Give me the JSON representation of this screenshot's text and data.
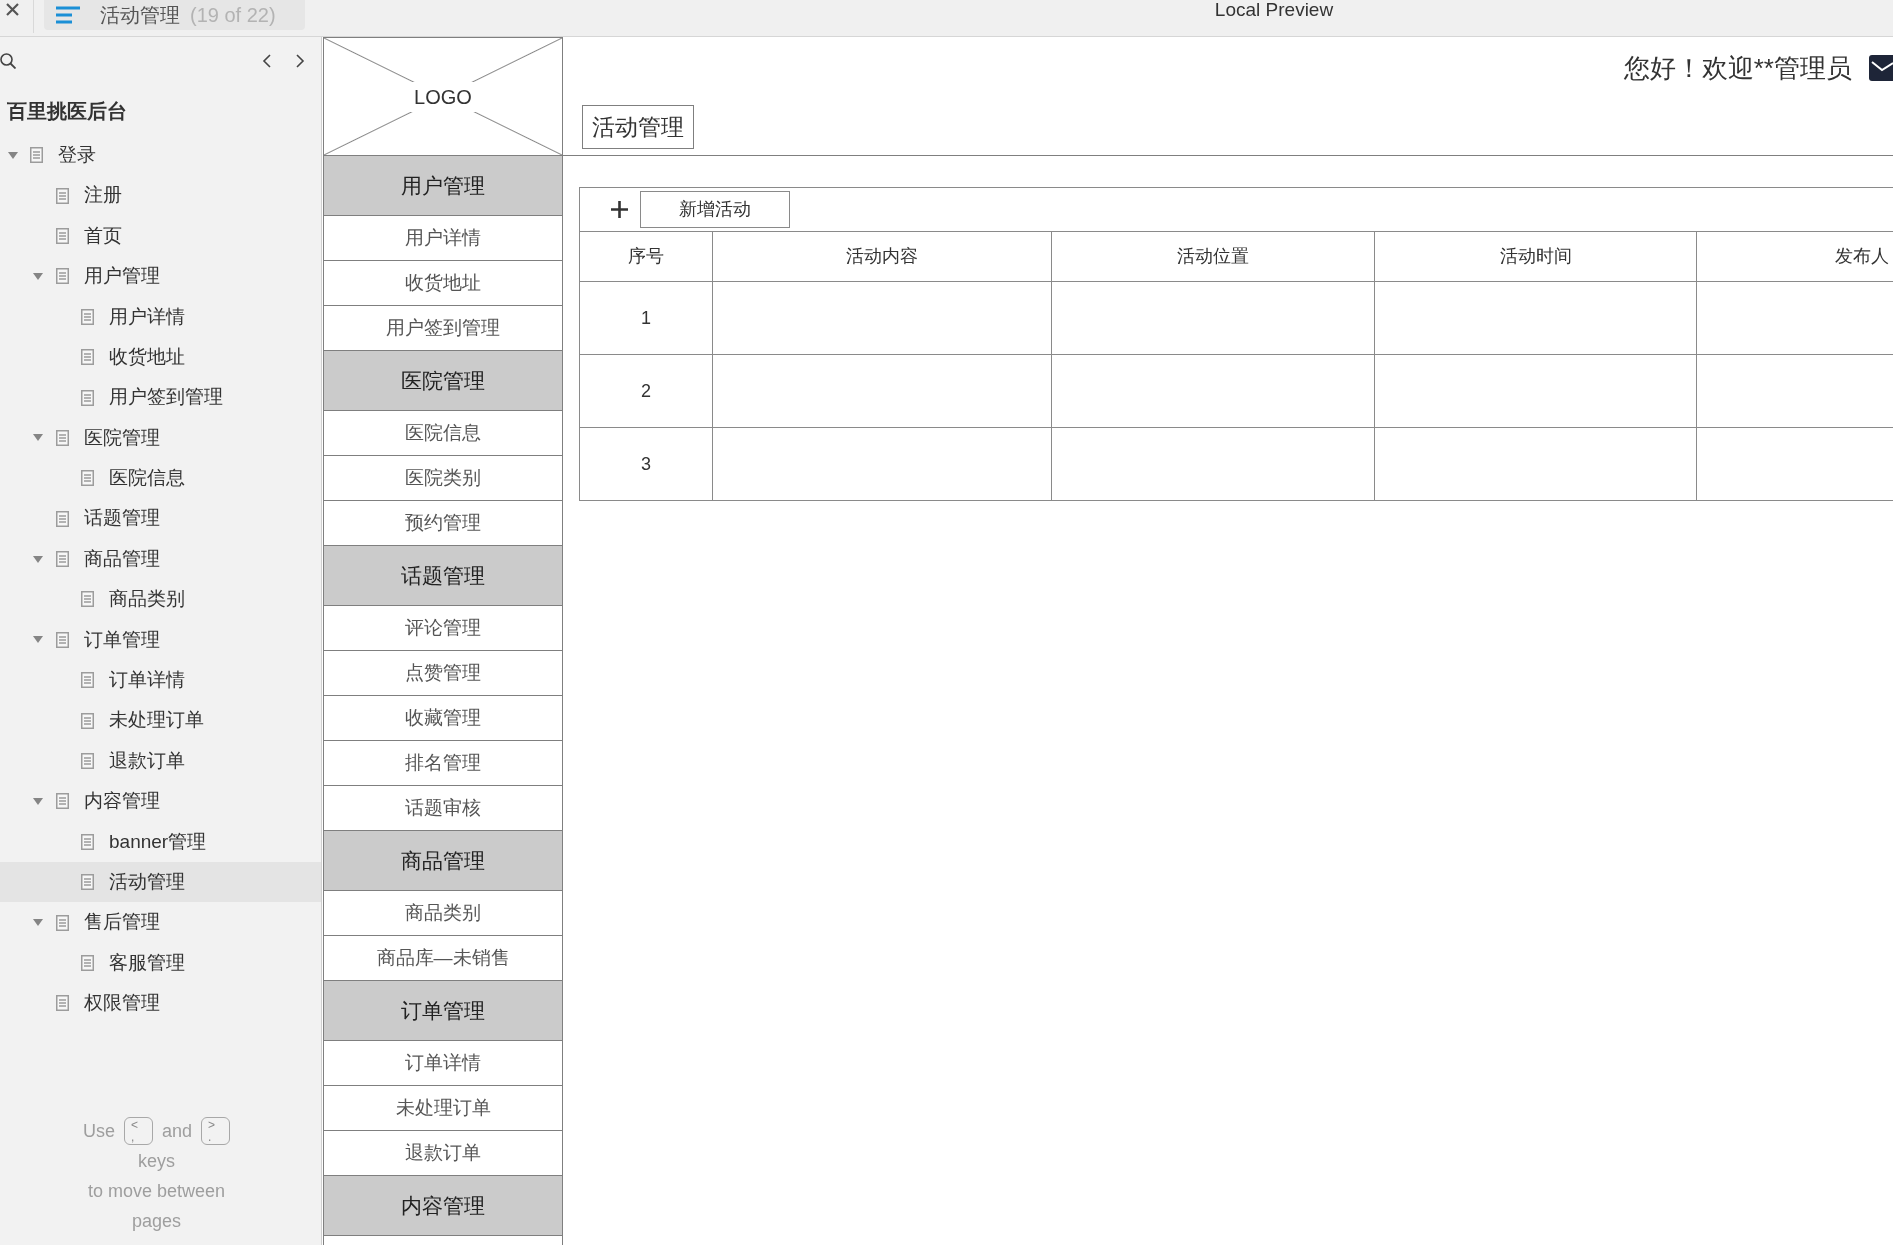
{
  "top_bar": {
    "tab": {
      "title": "活动管理",
      "count": "(19 of 22)"
    },
    "window_title": "Local Preview"
  },
  "sidebar": {
    "project_title": "百里挑医后台",
    "tree": [
      {
        "label": "登录",
        "expanded": true,
        "selected": false,
        "children": [
          {
            "label": "注册",
            "selected": false
          },
          {
            "label": "首页",
            "selected": false
          },
          {
            "label": "用户管理",
            "expanded": true,
            "selected": false,
            "children": [
              {
                "label": "用户详情",
                "selected": false
              },
              {
                "label": "收货地址",
                "selected": false
              },
              {
                "label": "用户签到管理",
                "selected": false
              }
            ]
          },
          {
            "label": "医院管理",
            "expanded": true,
            "selected": false,
            "children": [
              {
                "label": "医院信息",
                "selected": false
              }
            ]
          },
          {
            "label": "话题管理",
            "selected": false
          },
          {
            "label": "商品管理",
            "expanded": true,
            "selected": false,
            "children": [
              {
                "label": "商品类别",
                "selected": false
              }
            ]
          },
          {
            "label": "订单管理",
            "expanded": true,
            "selected": false,
            "children": [
              {
                "label": "订单详情",
                "selected": false
              },
              {
                "label": "未处理订单",
                "selected": false
              },
              {
                "label": "退款订单",
                "selected": false
              }
            ]
          },
          {
            "label": "内容管理",
            "expanded": true,
            "selected": false,
            "children": [
              {
                "label": "banner管理",
                "selected": false
              },
              {
                "label": "活动管理",
                "selected": true
              }
            ]
          },
          {
            "label": "售后管理",
            "expanded": true,
            "selected": false,
            "children": [
              {
                "label": "客服管理",
                "selected": false
              }
            ]
          },
          {
            "label": "权限管理",
            "selected": false
          }
        ]
      }
    ],
    "key_hint": {
      "lead": "Use",
      "keys": [
        {
          "upper": "<",
          "lower": ","
        },
        {
          "upper": ">",
          "lower": "."
        }
      ],
      "joiner": "and",
      "lines": [
        "keys",
        "to move between",
        "pages"
      ]
    }
  },
  "nav_menu": {
    "logo_text": "LOGO",
    "groups": [
      {
        "title": "用户管理",
        "items": [
          "用户详情",
          "收货地址",
          "用户签到管理"
        ]
      },
      {
        "title": "医院管理",
        "items": [
          "医院信息",
          "医院类别",
          "预约管理"
        ]
      },
      {
        "title": "话题管理",
        "items": [
          "评论管理",
          "点赞管理",
          "收藏管理",
          "排名管理",
          "话题审核"
        ]
      },
      {
        "title": "商品管理",
        "items": [
          "商品类别",
          "商品库—未销售"
        ]
      },
      {
        "title": "订单管理",
        "items": [
          "订单详情",
          "未处理订单",
          "退款订单"
        ]
      },
      {
        "title": "内容管理"
      }
    ]
  },
  "header": {
    "greeting": "您好！欢迎**管理员",
    "page_title": "活动管理"
  },
  "table": {
    "add_button": "新增活动",
    "columns": [
      "序号",
      "活动内容",
      "活动位置",
      "活动时间",
      "发布人"
    ],
    "rows": [
      {
        "index": "1"
      },
      {
        "index": "2"
      },
      {
        "index": "3"
      }
    ]
  }
}
